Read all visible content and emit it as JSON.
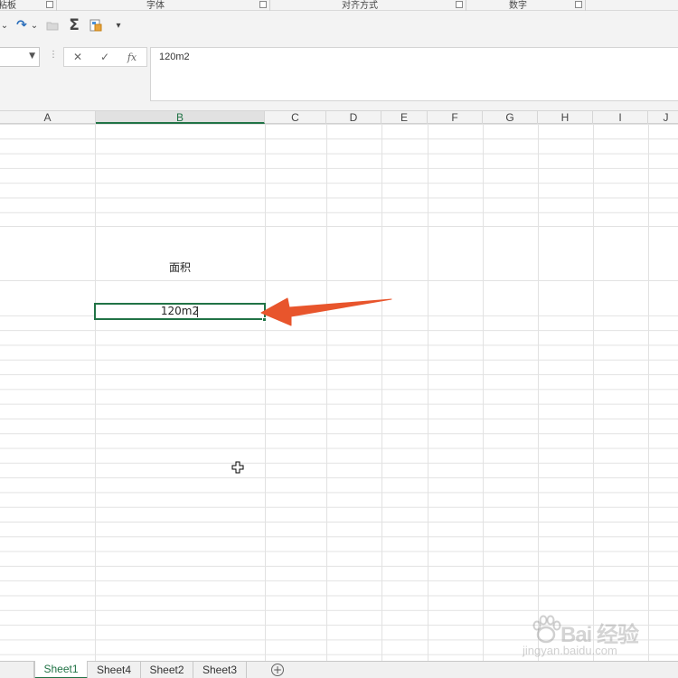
{
  "ribbon": {
    "groups": [
      {
        "label": "粘板",
        "name": "clipboard"
      },
      {
        "label": "字体",
        "name": "font"
      },
      {
        "label": "对齐方式",
        "name": "alignment"
      },
      {
        "label": "数字",
        "name": "number"
      }
    ]
  },
  "qat": {
    "undo_arrow": "⌄",
    "redo_icon": "↷",
    "redo_arrow": "⌄",
    "sum_icon": "Σ",
    "customize_icon": "▾"
  },
  "formula_bar": {
    "name_box_value": "",
    "cancel_icon": "✕",
    "enter_icon": "✓",
    "fx_icon": "fx",
    "content": "120m2"
  },
  "columns": [
    "A",
    "B",
    "C",
    "D",
    "E",
    "F",
    "G",
    "H",
    "I",
    "J"
  ],
  "selected_column": "B",
  "cells": {
    "b_label": "面积",
    "b_active": "120m2"
  },
  "sheets": [
    "Sheet1",
    "Sheet4",
    "Sheet2",
    "Sheet3"
  ],
  "active_sheet": "Sheet1",
  "add_sheet_icon": "+",
  "watermark": {
    "text": "Bai 经验",
    "url": "jingyan.baidu.com"
  },
  "colors": {
    "accent": "#217346",
    "arrow": "#e8552c"
  }
}
